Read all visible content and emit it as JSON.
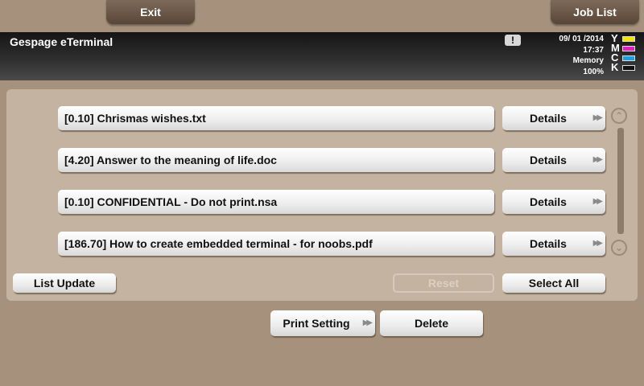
{
  "top_buttons": {
    "exit": "Exit",
    "job_list": "Job List"
  },
  "status_bar": {
    "app_title": "Gespage eTerminal",
    "alert": "!",
    "date": "09/ 01 /2014",
    "time": "17:37",
    "memory_label": "Memory",
    "memory_value": "100%",
    "toner": [
      {
        "letter": "Y",
        "color": "#f2e600"
      },
      {
        "letter": "M",
        "color": "#e020c0"
      },
      {
        "letter": "C",
        "color": "#1aa0e0"
      },
      {
        "letter": "K",
        "color": "#111111"
      }
    ]
  },
  "jobs": [
    {
      "title": "[0.10] Chrismas wishes.txt",
      "details": "Details"
    },
    {
      "title": "[4.20] Answer to the meaning of life.doc",
      "details": "Details"
    },
    {
      "title": "[0.10] CONFIDENTIAL - Do not print.nsa",
      "details": "Details"
    },
    {
      "title": "[186.70] How to create embedded terminal - for noobs.pdf",
      "details": "Details"
    }
  ],
  "list_actions": {
    "list_update": "List Update",
    "reset": "Reset",
    "select_all": "Select All"
  },
  "bottom_actions": {
    "print_setting": "Print Setting",
    "delete": "Delete"
  }
}
